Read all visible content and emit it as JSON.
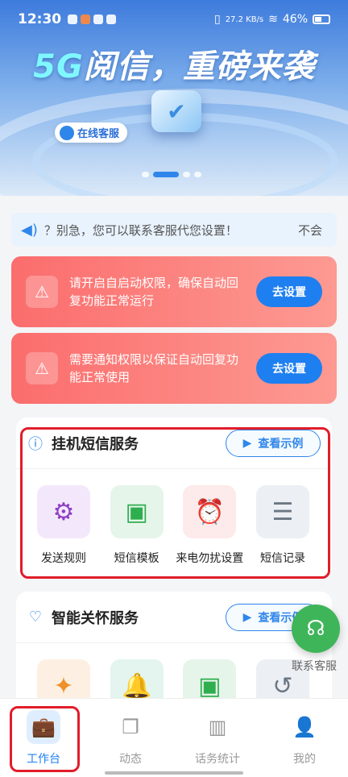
{
  "status_bar": {
    "time": "12:30",
    "network_speed": "27.2 KB/s",
    "battery": "46%"
  },
  "banner": {
    "title_5g": "5G",
    "title_rest": "阅信，重磅来袭",
    "online_service": "在线客服"
  },
  "notice": {
    "text": "？别急，您可以联系客服代您设置！",
    "tail": "不会"
  },
  "warnings": [
    {
      "text": "请开启自启动权限，确保自动回复功能正常运行",
      "button": "去设置"
    },
    {
      "text": "需要通知权限以保证自动回复功能正常使用",
      "button": "去设置"
    }
  ],
  "sms_service": {
    "title": "挂机短信服务",
    "example_button": "查看示例",
    "items": [
      {
        "label": "发送规则",
        "icon": "gear-icon"
      },
      {
        "label": "短信模板",
        "icon": "message-icon"
      },
      {
        "label": "来电勿扰设置",
        "icon": "alarm-clock-icon"
      },
      {
        "label": "短信记录",
        "icon": "list-icon"
      }
    ]
  },
  "care_service": {
    "title": "智能关怀服务",
    "example_button": "查看示例"
  },
  "float_contact": {
    "label": "联系客服"
  },
  "bottom_nav": [
    {
      "label": "工作台",
      "active": true
    },
    {
      "label": "动态"
    },
    {
      "label": "话务统计"
    },
    {
      "label": "我的"
    }
  ],
  "colors": {
    "accent": "#1e7ff0",
    "warning": "#fb6d6d",
    "highlight": "#e11d2a",
    "contact": "#3fb55a"
  }
}
